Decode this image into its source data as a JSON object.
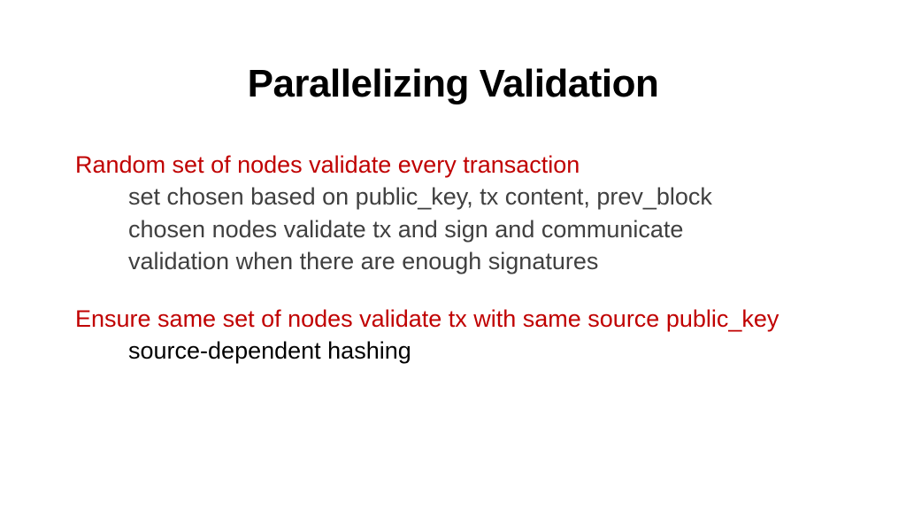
{
  "title": "Parallelizing Validation",
  "sections": [
    {
      "header": "Random set of nodes validate every transaction",
      "lines": [
        {
          "text": "set chosen based on public_key, tx content, prev_block",
          "color": "gray"
        },
        {
          "text": "chosen nodes validate tx and sign and communicate",
          "color": "gray"
        },
        {
          "text": "validation when there are enough signatures",
          "color": "gray"
        }
      ]
    },
    {
      "header": "Ensure same set of nodes validate tx with same source public_key",
      "lines": [
        {
          "text": "source-dependent hashing",
          "color": "black"
        }
      ]
    }
  ]
}
